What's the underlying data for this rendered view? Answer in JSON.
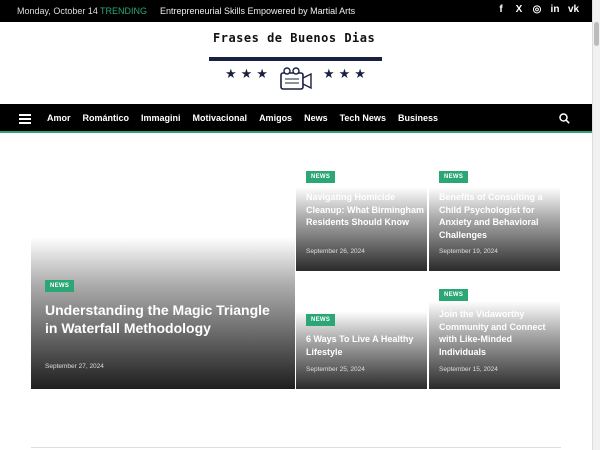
{
  "topbar": {
    "date": "Monday, October 14",
    "trending_label": "TRENDING",
    "trending_headline": "Entrepreneurial Skills Empowered by Martial Arts",
    "socials": [
      "facebook-icon",
      "x-icon",
      "instagram-icon",
      "linkedin-icon",
      "vk-icon"
    ],
    "socials_glyphs": [
      "f",
      "X",
      "◎",
      "in",
      "vk"
    ]
  },
  "header": {
    "site_title": "Frases de Buenos Dias",
    "stars_left": "★★★",
    "stars_right": "★★★"
  },
  "nav": {
    "items": [
      "Amor",
      "Romántico",
      "Immagini",
      "Motivacional",
      "Amigos",
      "News",
      "Tech News",
      "Business"
    ]
  },
  "featured": {
    "main": {
      "badge": "NEWS",
      "title": "Understanding the Magic Triangle in Waterfall Methodology",
      "date": "September 27, 2024"
    },
    "cards": [
      {
        "badge": "NEWS",
        "title": "Navigating Homicide Cleanup: What Birmingham Residents Should Know",
        "date": "September 26, 2024"
      },
      {
        "badge": "NEWS",
        "title": "Benefits of Consulting a Child Psychologist for Anxiety and Behavioral Challenges",
        "date": "September 19, 2024"
      },
      {
        "badge": "NEWS",
        "title": "6 Ways To Live A Healthy Lifestyle",
        "date": "September 25, 2024"
      },
      {
        "badge": "NEWS",
        "title": "Join the Vidaworthy Community and Connect with Like-Minded Individuals",
        "date": "September 15, 2024"
      }
    ]
  },
  "colors": {
    "accent": "#2aa774",
    "topbar_bg": "#000000",
    "logo_navy": "#1a2040"
  }
}
